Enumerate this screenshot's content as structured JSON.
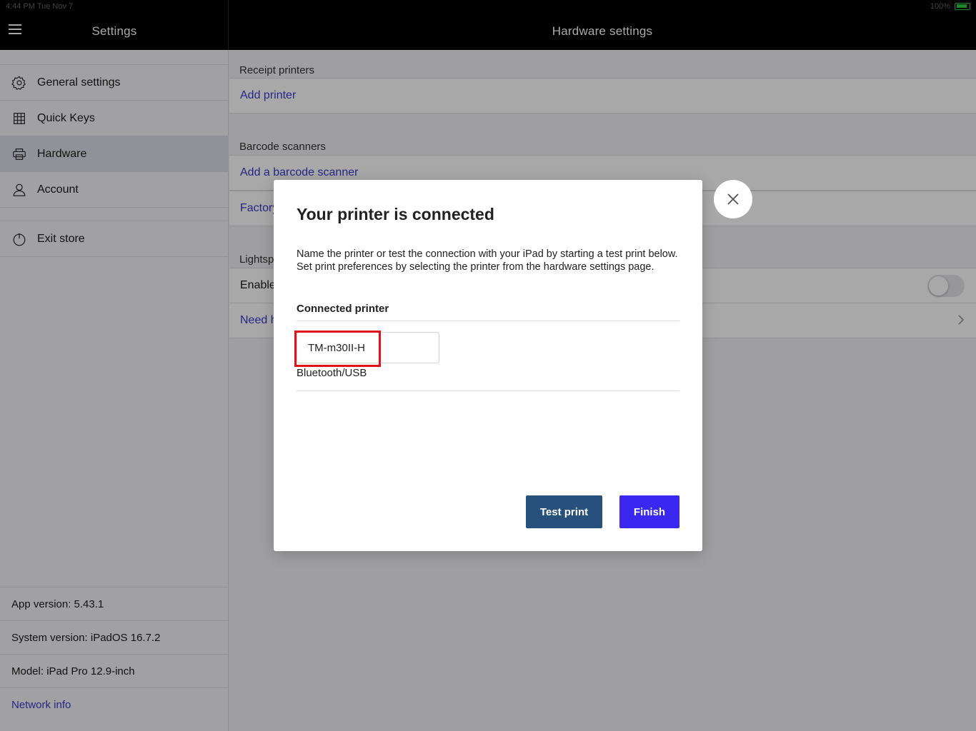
{
  "status_bar": {
    "time": "4:44 PM",
    "date": "Tue Nov 7",
    "battery": "100%"
  },
  "sidebar": {
    "title": "Settings",
    "items": [
      {
        "label": "General settings",
        "icon": "gear-icon"
      },
      {
        "label": "Quick Keys",
        "icon": "grid-icon"
      },
      {
        "label": "Hardware",
        "icon": "printer-icon",
        "active": true
      },
      {
        "label": "Account",
        "icon": "user-icon"
      }
    ],
    "exit_label": "Exit store",
    "info": {
      "app_version": "App version: 5.43.1",
      "system_version": "System version: iPadOS 16.7.2",
      "model": "Model: iPad Pro 12.9-inch",
      "network_link": "Network info"
    }
  },
  "main": {
    "title": "Hardware settings",
    "sections": {
      "receipt_printers": {
        "header": "Receipt printers",
        "add_label": "Add printer"
      },
      "barcode_scanners": {
        "header": "Barcode scanners",
        "add_label": "Add a barcode scanner",
        "factory_label": "Factory"
      },
      "lightspeed": {
        "header": "Lightsp",
        "enable_label": "Enable",
        "help_label": "Need h"
      }
    }
  },
  "modal": {
    "title": "Your printer is connected",
    "description": "Name the printer or test the connection with your iPad by starting a test print below. Set print preferences by selecting the printer from the hardware settings page.",
    "connected_label": "Connected printer",
    "printer_name": "TM-m30II-H",
    "connection_type": "Bluetooth/USB",
    "test_print_label": "Test print",
    "finish_label": "Finish"
  },
  "colors": {
    "accent": "#3a28f0",
    "test_button": "#28507c",
    "link": "#3a3acc",
    "highlight": "#e0121c"
  }
}
